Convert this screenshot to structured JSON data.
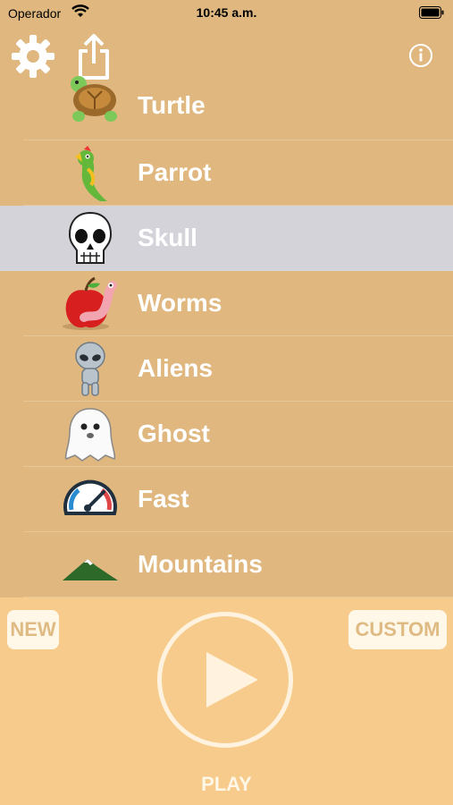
{
  "status_bar": {
    "carrier": "Operador",
    "time": "10:45 a.m."
  },
  "toolbar": {
    "settings_icon": "gear-icon",
    "share_icon": "share-icon",
    "info_icon": "info-icon"
  },
  "songs": [
    {
      "label": "Turtle",
      "icon": "turtle-icon"
    },
    {
      "label": "Parrot",
      "icon": "parrot-icon"
    },
    {
      "label": "Skull",
      "icon": "skull-icon",
      "selected": true
    },
    {
      "label": "Worms",
      "icon": "worm-apple-icon"
    },
    {
      "label": "Aliens",
      "icon": "alien-icon"
    },
    {
      "label": "Ghost",
      "icon": "ghost-icon"
    },
    {
      "label": "Fast",
      "icon": "speedometer-icon"
    },
    {
      "label": "Mountains",
      "icon": "mountain-icon"
    }
  ],
  "footer": {
    "new_label": "NEW",
    "custom_label": "CUSTOM",
    "play_label": "PLAY"
  },
  "colors": {
    "background": "#dfb77f",
    "footer": "#f7cb8b",
    "selected_row": "#d4d3d9",
    "label": "#ffffff"
  }
}
